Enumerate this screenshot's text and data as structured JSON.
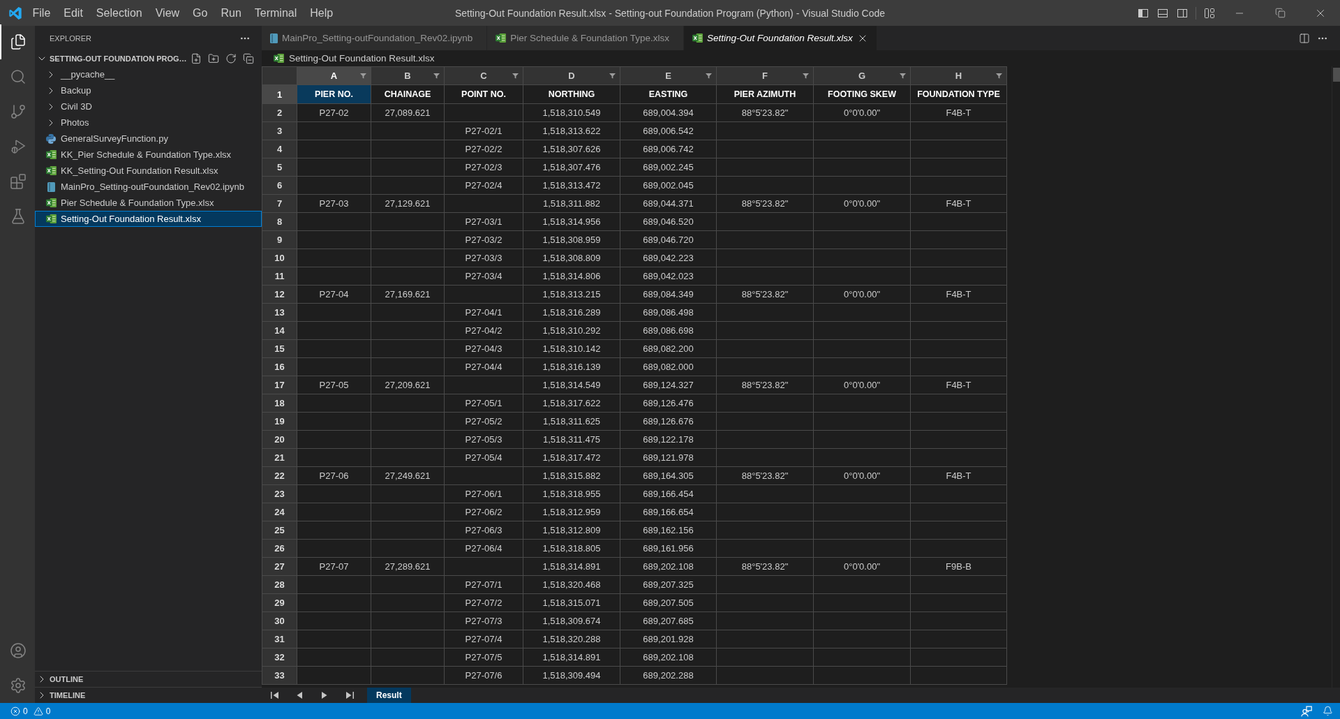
{
  "title_bar": {
    "menu": [
      "File",
      "Edit",
      "Selection",
      "View",
      "Go",
      "Run",
      "Terminal",
      "Help"
    ],
    "title": "Setting-Out Foundation Result.xlsx - Setting-out Foundation Program (Python) - Visual Studio Code",
    "layout_toggles": [
      {
        "kind": "primary_sidebar",
        "on": true
      },
      {
        "kind": "panel",
        "on": false
      },
      {
        "kind": "secondary_sidebar",
        "on": false
      }
    ]
  },
  "activity_bar": {
    "items": [
      {
        "kind": "explorer",
        "selected": true
      },
      {
        "kind": "search",
        "selected": false
      },
      {
        "kind": "source_control",
        "selected": false
      },
      {
        "kind": "run_debug",
        "selected": false
      },
      {
        "kind": "extensions",
        "selected": false
      },
      {
        "kind": "testing",
        "selected": false
      }
    ],
    "bottom_items": [
      {
        "kind": "accounts"
      },
      {
        "kind": "manage"
      }
    ]
  },
  "sidebar": {
    "title": "EXPLORER",
    "folder": {
      "name": "SETTING-OUT FOUNDATION PROG…",
      "expanded": true,
      "children": [
        {
          "name": "__pycache__",
          "kind": "folder",
          "expanded": false,
          "selected": false
        },
        {
          "name": "Backup",
          "kind": "folder",
          "expanded": false,
          "selected": false
        },
        {
          "name": "Civil 3D",
          "kind": "folder",
          "expanded": false,
          "selected": false
        },
        {
          "name": "Photos",
          "kind": "folder",
          "expanded": false,
          "selected": false
        },
        {
          "name": "GeneralSurveyFunction.py",
          "kind": "python",
          "selected": false
        },
        {
          "name": "KK_Pier Schedule & Foundation Type.xlsx",
          "kind": "excel",
          "selected": false
        },
        {
          "name": "KK_Setting-Out Foundation Result.xlsx",
          "kind": "excel",
          "selected": false
        },
        {
          "name": "MainPro_Setting-outFoundation_Rev02.ipynb",
          "kind": "notebook",
          "selected": false
        },
        {
          "name": "Pier Schedule & Foundation Type.xlsx",
          "kind": "excel",
          "selected": false
        },
        {
          "name": "Setting-Out Foundation Result.xlsx",
          "kind": "excel",
          "selected": true
        }
      ]
    },
    "sections": [
      {
        "label": "OUTLINE",
        "expanded": false
      },
      {
        "label": "TIMELINE",
        "expanded": false
      }
    ]
  },
  "tabs": [
    {
      "label": "MainPro_Setting-outFoundation_Rev02.ipynb",
      "kind": "notebook",
      "selected": false,
      "preview": false
    },
    {
      "label": "Pier Schedule & Foundation Type.xlsx",
      "kind": "excel",
      "selected": false,
      "preview": false
    },
    {
      "label": "Setting-Out Foundation Result.xlsx",
      "kind": "excel",
      "selected": true,
      "preview": true
    }
  ],
  "breadcrumb": {
    "kind": "excel",
    "label": "Setting-Out Foundation Result.xlsx"
  },
  "sheet": {
    "columns": [
      {
        "letter": "A",
        "selected": true
      },
      {
        "letter": "B",
        "selected": false
      },
      {
        "letter": "C",
        "selected": false
      },
      {
        "letter": "D",
        "selected": false
      },
      {
        "letter": "E",
        "selected": false
      },
      {
        "letter": "F",
        "selected": false
      },
      {
        "letter": "G",
        "selected": false
      },
      {
        "letter": "H",
        "selected": false
      }
    ],
    "rows": [
      {
        "number": "1",
        "kind": "header",
        "selected": true,
        "pier_no": "PIER NO.",
        "chainage": "CHAINAGE",
        "point_no": "POINT NO.",
        "northing": "NORTHING",
        "easting": "EASTING",
        "pier_azimuth": "PIER AZIMUTH",
        "footing_skew": "FOOTING SKEW",
        "foundation_type": "FOUNDATION TYPE"
      },
      {
        "number": "2",
        "kind": "data",
        "selected": false,
        "pier_no": "P27-02",
        "chainage": "27,089.621",
        "northing": "1,518,310.549",
        "easting": "689,004.394",
        "pier_azimuth": "88°5'23.82\"",
        "footing_skew": "0°0'0.00\"",
        "foundation_type": "F4B-T"
      },
      {
        "number": "3",
        "kind": "data",
        "selected": false,
        "point_no": "P27-02/1",
        "northing": "1,518,313.622",
        "easting": "689,006.542"
      },
      {
        "number": "4",
        "kind": "data",
        "selected": false,
        "point_no": "P27-02/2",
        "northing": "1,518,307.626",
        "easting": "689,006.742"
      },
      {
        "number": "5",
        "kind": "data",
        "selected": false,
        "point_no": "P27-02/3",
        "northing": "1,518,307.476",
        "easting": "689,002.245"
      },
      {
        "number": "6",
        "kind": "data",
        "selected": false,
        "point_no": "P27-02/4",
        "northing": "1,518,313.472",
        "easting": "689,002.045"
      },
      {
        "number": "7",
        "kind": "data",
        "selected": false,
        "pier_no": "P27-03",
        "chainage": "27,129.621",
        "northing": "1,518,311.882",
        "easting": "689,044.371",
        "pier_azimuth": "88°5'23.82\"",
        "footing_skew": "0°0'0.00\"",
        "foundation_type": "F4B-T"
      },
      {
        "number": "8",
        "kind": "data",
        "selected": false,
        "point_no": "P27-03/1",
        "northing": "1,518,314.956",
        "easting": "689,046.520"
      },
      {
        "number": "9",
        "kind": "data",
        "selected": false,
        "point_no": "P27-03/2",
        "northing": "1,518,308.959",
        "easting": "689,046.720"
      },
      {
        "number": "10",
        "kind": "data",
        "selected": false,
        "point_no": "P27-03/3",
        "northing": "1,518,308.809",
        "easting": "689,042.223"
      },
      {
        "number": "11",
        "kind": "data",
        "selected": false,
        "point_no": "P27-03/4",
        "northing": "1,518,314.806",
        "easting": "689,042.023"
      },
      {
        "number": "12",
        "kind": "data",
        "selected": false,
        "pier_no": "P27-04",
        "chainage": "27,169.621",
        "northing": "1,518,313.215",
        "easting": "689,084.349",
        "pier_azimuth": "88°5'23.82\"",
        "footing_skew": "0°0'0.00\"",
        "foundation_type": "F4B-T"
      },
      {
        "number": "13",
        "kind": "data",
        "selected": false,
        "point_no": "P27-04/1",
        "northing": "1,518,316.289",
        "easting": "689,086.498"
      },
      {
        "number": "14",
        "kind": "data",
        "selected": false,
        "point_no": "P27-04/2",
        "northing": "1,518,310.292",
        "easting": "689,086.698"
      },
      {
        "number": "15",
        "kind": "data",
        "selected": false,
        "point_no": "P27-04/3",
        "northing": "1,518,310.142",
        "easting": "689,082.200"
      },
      {
        "number": "16",
        "kind": "data",
        "selected": false,
        "point_no": "P27-04/4",
        "northing": "1,518,316.139",
        "easting": "689,082.000"
      },
      {
        "number": "17",
        "kind": "data",
        "selected": false,
        "pier_no": "P27-05",
        "chainage": "27,209.621",
        "northing": "1,518,314.549",
        "easting": "689,124.327",
        "pier_azimuth": "88°5'23.82\"",
        "footing_skew": "0°0'0.00\"",
        "foundation_type": "F4B-T"
      },
      {
        "number": "18",
        "kind": "data",
        "selected": false,
        "point_no": "P27-05/1",
        "northing": "1,518,317.622",
        "easting": "689,126.476"
      },
      {
        "number": "19",
        "kind": "data",
        "selected": false,
        "point_no": "P27-05/2",
        "northing": "1,518,311.625",
        "easting": "689,126.676"
      },
      {
        "number": "20",
        "kind": "data",
        "selected": false,
        "point_no": "P27-05/3",
        "northing": "1,518,311.475",
        "easting": "689,122.178"
      },
      {
        "number": "21",
        "kind": "data",
        "selected": false,
        "point_no": "P27-05/4",
        "northing": "1,518,317.472",
        "easting": "689,121.978"
      },
      {
        "number": "22",
        "kind": "data",
        "selected": false,
        "pier_no": "P27-06",
        "chainage": "27,249.621",
        "northing": "1,518,315.882",
        "easting": "689,164.305",
        "pier_azimuth": "88°5'23.82\"",
        "footing_skew": "0°0'0.00\"",
        "foundation_type": "F4B-T"
      },
      {
        "number": "23",
        "kind": "data",
        "selected": false,
        "point_no": "P27-06/1",
        "northing": "1,518,318.955",
        "easting": "689,166.454"
      },
      {
        "number": "24",
        "kind": "data",
        "selected": false,
        "point_no": "P27-06/2",
        "northing": "1,518,312.959",
        "easting": "689,166.654"
      },
      {
        "number": "25",
        "kind": "data",
        "selected": false,
        "point_no": "P27-06/3",
        "northing": "1,518,312.809",
        "easting": "689,162.156"
      },
      {
        "number": "26",
        "kind": "data",
        "selected": false,
        "point_no": "P27-06/4",
        "northing": "1,518,318.805",
        "easting": "689,161.956"
      },
      {
        "number": "27",
        "kind": "data",
        "selected": false,
        "pier_no": "P27-07",
        "chainage": "27,289.621",
        "northing": "1,518,314.891",
        "easting": "689,202.108",
        "pier_azimuth": "88°5'23.82\"",
        "footing_skew": "0°0'0.00\"",
        "foundation_type": "F9B-B"
      },
      {
        "number": "28",
        "kind": "data",
        "selected": false,
        "point_no": "P27-07/1",
        "northing": "1,518,320.468",
        "easting": "689,207.325"
      },
      {
        "number": "29",
        "kind": "data",
        "selected": false,
        "point_no": "P27-07/2",
        "northing": "1,518,315.071",
        "easting": "689,207.505"
      },
      {
        "number": "30",
        "kind": "data",
        "selected": false,
        "point_no": "P27-07/3",
        "northing": "1,518,309.674",
        "easting": "689,207.685"
      },
      {
        "number": "31",
        "kind": "data",
        "selected": false,
        "point_no": "P27-07/4",
        "northing": "1,518,320.288",
        "easting": "689,201.928"
      },
      {
        "number": "32",
        "kind": "data",
        "selected": false,
        "point_no": "P27-07/5",
        "northing": "1,518,314.891",
        "easting": "689,202.108"
      },
      {
        "number": "33",
        "kind": "data",
        "selected": false,
        "point_no": "P27-07/6",
        "northing": "1,518,309.494",
        "easting": "689,202.288"
      }
    ]
  },
  "sheet_tabs": [
    {
      "label": "Result",
      "selected": true
    }
  ],
  "status_bar": {
    "errors": "0",
    "warnings": "0"
  }
}
